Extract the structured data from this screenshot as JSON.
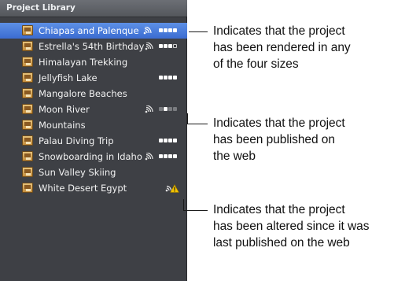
{
  "panel": {
    "title": "Project Library",
    "projects": [
      {
        "label": "Chiapas and Palenque",
        "selected": true
      },
      {
        "label": "Estrella's 54th Birthday",
        "selected": false
      },
      {
        "label": "Himalayan Trekking",
        "selected": false
      },
      {
        "label": "Jellyfish Lake",
        "selected": false
      },
      {
        "label": "Mangalore Beaches",
        "selected": false
      },
      {
        "label": "Moon River",
        "selected": false
      },
      {
        "label": "Mountains",
        "selected": false
      },
      {
        "label": "Palau Diving Trip",
        "selected": false
      },
      {
        "label": "Snowboarding in Idaho",
        "selected": false
      },
      {
        "label": "Sun Valley Skiing",
        "selected": false
      },
      {
        "label": "White Desert Egypt",
        "selected": false
      }
    ]
  },
  "callouts": [
    {
      "text": "Indicates that the project\nhas been rendered in any\nof the four sizes"
    },
    {
      "text": "Indicates that the project\nhas been published on\nthe web"
    },
    {
      "text": "Indicates that the project\nhas been altered since it was\nlast published on the web"
    }
  ],
  "colors": {
    "selection": "#3b6cd1",
    "panel_background": "#3e4045",
    "warning": "#f2c200"
  }
}
